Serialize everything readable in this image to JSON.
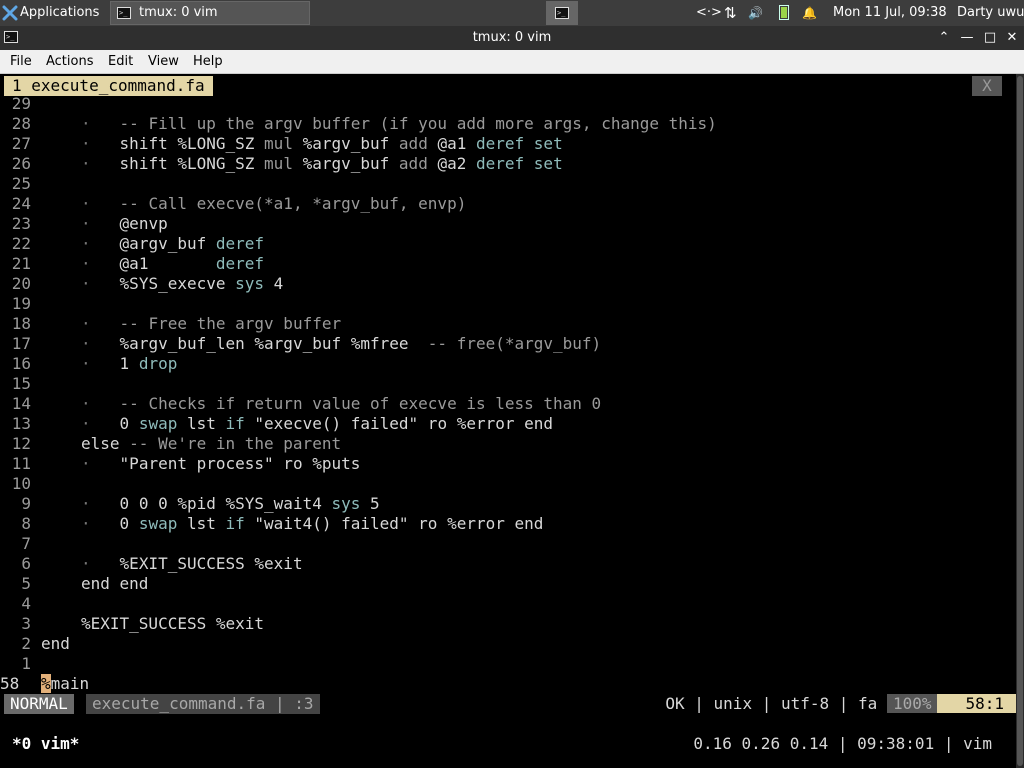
{
  "panel": {
    "apps_label": "Applications",
    "task_label": "tmux: 0 vim",
    "datetime": "Mon 11 Jul, 09:38",
    "user": "Darty uwu",
    "network_icon": "<·>",
    "transfer_icon": "⇅",
    "volume_icon": "🔊",
    "bell_icon": "🔔"
  },
  "window": {
    "title": "tmux: 0 vim",
    "up_glyph": "⌃",
    "min_glyph": "—",
    "max_glyph": "□",
    "close_glyph": "✕"
  },
  "menubar": {
    "file": "File",
    "actions": "Actions",
    "edit": "Edit",
    "view": "View",
    "help": "Help"
  },
  "vim": {
    "tab_label": "1 execute_command.fa",
    "tab_close": "X",
    "lines": [
      {
        "n": "29",
        "pre": "",
        "parts": []
      },
      {
        "n": "28",
        "pre": "·",
        "parts": [
          {
            "t": "-- Fill up the argv buffer (if you add more args, change this)",
            "c": "cm"
          }
        ]
      },
      {
        "n": "27",
        "pre": "·",
        "parts": [
          {
            "t": "shift %LONG_SZ ",
            "c": ""
          },
          {
            "t": "mul",
            "c": "cm"
          },
          {
            "t": " %argv_buf ",
            "c": ""
          },
          {
            "t": "add",
            "c": "cm"
          },
          {
            "t": " @a1 ",
            "c": ""
          },
          {
            "t": "deref set",
            "c": "kw"
          }
        ]
      },
      {
        "n": "26",
        "pre": "·",
        "parts": [
          {
            "t": "shift %LONG_SZ ",
            "c": ""
          },
          {
            "t": "mul",
            "c": "cm"
          },
          {
            "t": " %argv_buf ",
            "c": ""
          },
          {
            "t": "add",
            "c": "cm"
          },
          {
            "t": " @a2 ",
            "c": ""
          },
          {
            "t": "deref set",
            "c": "kw"
          }
        ]
      },
      {
        "n": "25",
        "pre": "",
        "parts": []
      },
      {
        "n": "24",
        "pre": "·",
        "parts": [
          {
            "t": "-- Call execve(*a1, *argv_buf, envp)",
            "c": "cm"
          }
        ]
      },
      {
        "n": "23",
        "pre": "·",
        "parts": [
          {
            "t": "@envp",
            "c": "st"
          }
        ]
      },
      {
        "n": "22",
        "pre": "·",
        "parts": [
          {
            "t": "@argv_buf ",
            "c": ""
          },
          {
            "t": "deref",
            "c": "kw"
          }
        ]
      },
      {
        "n": "21",
        "pre": "·",
        "parts": [
          {
            "t": "@a1       ",
            "c": ""
          },
          {
            "t": "deref",
            "c": "kw"
          }
        ]
      },
      {
        "n": "20",
        "pre": "·",
        "parts": [
          {
            "t": "%SYS_execve ",
            "c": ""
          },
          {
            "t": "sys",
            "c": "kw"
          },
          {
            "t": " 4",
            "c": ""
          }
        ]
      },
      {
        "n": "19",
        "pre": "",
        "parts": []
      },
      {
        "n": "18",
        "pre": "·",
        "parts": [
          {
            "t": "-- Free the argv buffer",
            "c": "cm"
          }
        ]
      },
      {
        "n": "17",
        "pre": "·",
        "parts": [
          {
            "t": "%argv_buf_len %argv_buf %mfree  ",
            "c": ""
          },
          {
            "t": "-- free(*argv_buf)",
            "c": "cm"
          }
        ]
      },
      {
        "n": "16",
        "pre": "·",
        "parts": [
          {
            "t": "1 ",
            "c": ""
          },
          {
            "t": "drop",
            "c": "kw"
          }
        ]
      },
      {
        "n": "15",
        "pre": "",
        "parts": []
      },
      {
        "n": "14",
        "pre": "·",
        "parts": [
          {
            "t": "-- Checks if return value of execve is less than 0",
            "c": "cm"
          }
        ]
      },
      {
        "n": "13",
        "pre": "·",
        "parts": [
          {
            "t": "0 ",
            "c": ""
          },
          {
            "t": "swap",
            "c": "kw"
          },
          {
            "t": " lst ",
            "c": ""
          },
          {
            "t": "if",
            "c": "kw"
          },
          {
            "t": " \"execve() failed\" ro %error end",
            "c": ""
          }
        ]
      },
      {
        "n": "12",
        "pre": "else",
        "parts": [
          {
            "t": " -- We're in the parent",
            "c": "cm"
          }
        ]
      },
      {
        "n": "11",
        "pre": "·",
        "parts": [
          {
            "t": "\"Parent process\" ro %puts",
            "c": ""
          }
        ]
      },
      {
        "n": "10",
        "pre": "",
        "parts": []
      },
      {
        "n": "9",
        "pre": "·",
        "parts": [
          {
            "t": "0 0 0 %pid %SYS_wait4 ",
            "c": ""
          },
          {
            "t": "sys",
            "c": "kw"
          },
          {
            "t": " 5",
            "c": ""
          }
        ]
      },
      {
        "n": "8",
        "pre": "·",
        "parts": [
          {
            "t": "0 ",
            "c": ""
          },
          {
            "t": "swap",
            "c": "kw"
          },
          {
            "t": " lst ",
            "c": ""
          },
          {
            "t": "if",
            "c": "kw"
          },
          {
            "t": " \"wait4() failed\" ro %error end",
            "c": ""
          }
        ]
      },
      {
        "n": "7",
        "pre": "",
        "parts": []
      },
      {
        "n": "6",
        "pre": "·",
        "parts": [
          {
            "t": "%EXIT_SUCCESS %exit",
            "c": ""
          }
        ]
      },
      {
        "n": "5",
        "pre": "end end",
        "parts": []
      },
      {
        "n": "4",
        "pre": "",
        "parts": []
      },
      {
        "n": "3",
        "pre": "%EXIT_SUCCESS %exit",
        "parts": []
      },
      {
        "n": "2",
        "pre": "end",
        "parts": [],
        "outer": true
      },
      {
        "n": "1",
        "pre": "",
        "parts": []
      }
    ],
    "current_line_number": "58",
    "current_line_cursor": "%",
    "current_line_rest": "main",
    "status": {
      "mode": "NORMAL",
      "file": "execute_command.fa | :3",
      "right": "OK | unix | utf-8 | fa ",
      "percent": "100%",
      "position": "58:1"
    }
  },
  "tmux": {
    "window": "*0 vim*",
    "right": "0.16 0.26 0.14 | 09:38:01 | vim"
  }
}
